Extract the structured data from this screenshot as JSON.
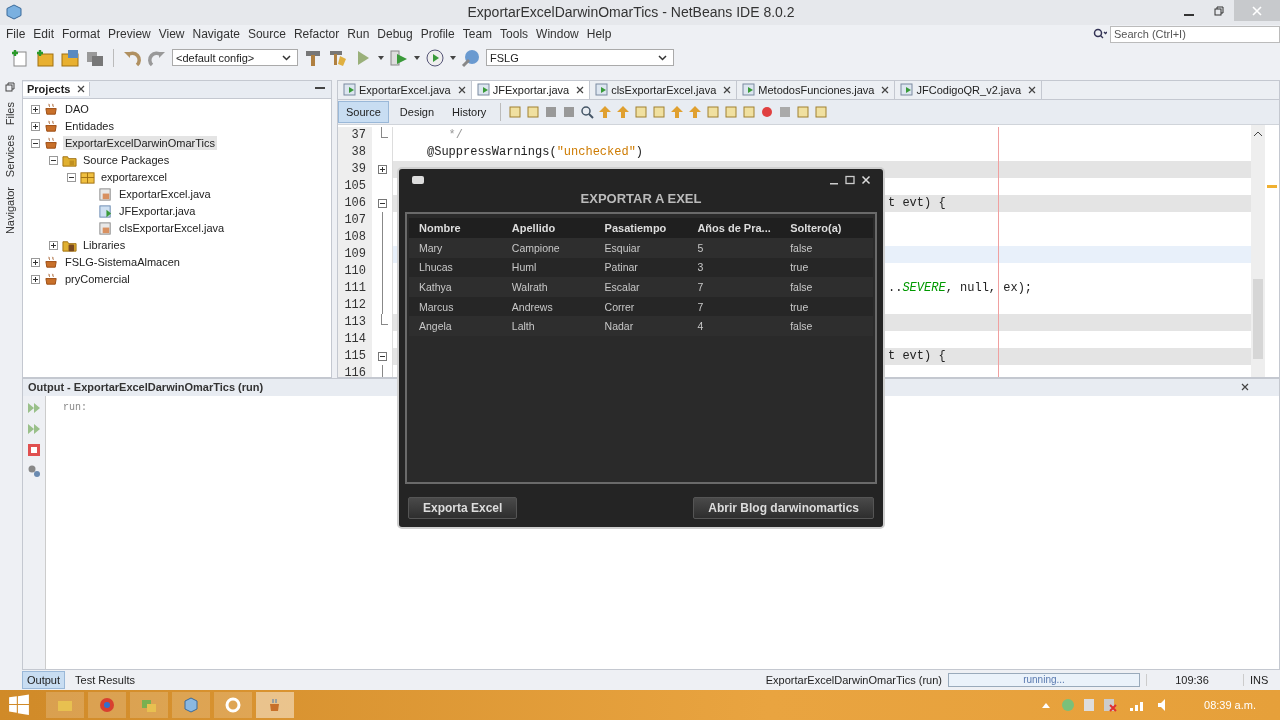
{
  "window": {
    "title": "ExportarExcelDarwinOmarTics - NetBeans IDE 8.0.2"
  },
  "menu": [
    "File",
    "Edit",
    "Format",
    "Preview",
    "View",
    "Navigate",
    "Source",
    "Refactor",
    "Run",
    "Debug",
    "Profile",
    "Team",
    "Tools",
    "Window",
    "Help"
  ],
  "toolbar": {
    "config": "<default config>",
    "project": "FSLG",
    "search_placeholder": "Search (Ctrl+I)"
  },
  "side_tabs": [
    "Files",
    "Services",
    "Navigator"
  ],
  "projects": {
    "title": "Projects",
    "tree": [
      {
        "label": "DAO",
        "kind": "project",
        "expanded": false,
        "selected": false
      },
      {
        "label": "Entidades",
        "kind": "project",
        "expanded": false,
        "selected": false
      },
      {
        "label": "ExportarExcelDarwinOmarTics",
        "kind": "project",
        "expanded": true,
        "selected": true,
        "children": [
          {
            "label": "Source Packages",
            "kind": "folder",
            "expanded": true,
            "selected": false,
            "children": [
              {
                "label": "exportarexcel",
                "kind": "package",
                "expanded": true,
                "selected": false,
                "children": [
                  {
                    "label": "ExportarExcel.java",
                    "kind": "file",
                    "selected": false
                  },
                  {
                    "label": "JFExportar.java",
                    "kind": "form",
                    "selected": false
                  },
                  {
                    "label": "clsExportarExcel.java",
                    "kind": "file",
                    "selected": false
                  }
                ]
              }
            ]
          },
          {
            "label": "Libraries",
            "kind": "library",
            "expanded": false,
            "selected": false
          }
        ]
      },
      {
        "label": "FSLG-SistemaAlmacen",
        "kind": "project",
        "expanded": false,
        "selected": false
      },
      {
        "label": "pryComercial",
        "kind": "project",
        "expanded": false,
        "selected": false
      }
    ]
  },
  "editor": {
    "tabs": [
      {
        "label": "ExportarExcel.java",
        "selected": false
      },
      {
        "label": "JFExportar.java",
        "selected": true
      },
      {
        "label": "clsExportarExcel.java",
        "selected": false
      },
      {
        "label": "MetodosFunciones.java",
        "selected": false
      },
      {
        "label": "JFCodigoQR_v2.java",
        "selected": false
      }
    ],
    "views": [
      {
        "label": "Source",
        "selected": true
      },
      {
        "label": "Design",
        "selected": false
      },
      {
        "label": "History",
        "selected": false
      }
    ],
    "lines": [
      {
        "number": "37",
        "fold": {
          "kind": "end"
        },
        "kind": "plain",
        "code": [
          {
            "t": "   */",
            "kind": "comment"
          }
        ]
      },
      {
        "number": "38",
        "kind": "plain",
        "code": [
          {
            "t": "@SuppressWarnings(",
            "kind": "plain"
          },
          {
            "t": "\"unchecked\"",
            "kind": "string"
          },
          {
            "t": ")",
            "kind": "plain"
          }
        ]
      },
      {
        "number": "39",
        "fold": {
          "kind": "expand"
        },
        "kind": "guarded"
      },
      {
        "number": "105",
        "kind": "plain"
      },
      {
        "number": "106",
        "fold": {
          "kind": "collapse"
        },
        "kind": "guarded",
        "tail": [
          {
            "t": "t evt) {",
            "kind": "plain"
          }
        ]
      },
      {
        "number": "107",
        "fold": {
          "kind": "line"
        },
        "kind": "plain"
      },
      {
        "number": "108",
        "fold": {
          "kind": "line"
        },
        "kind": "plain"
      },
      {
        "number": "109",
        "fold": {
          "kind": "line"
        },
        "kind": "current"
      },
      {
        "number": "110",
        "fold": {
          "kind": "line"
        },
        "kind": "plain"
      },
      {
        "number": "111",
        "fold": {
          "kind": "line"
        },
        "kind": "plain",
        "tail": [
          {
            "t": "..",
            "kind": "plain"
          },
          {
            "t": "SEVERE",
            "kind": "constant"
          },
          {
            "t": ", null, ex);",
            "kind": "plain"
          }
        ]
      },
      {
        "number": "112",
        "fold": {
          "kind": "line"
        },
        "kind": "plain"
      },
      {
        "number": "113",
        "fold": {
          "kind": "end"
        },
        "kind": "guarded"
      },
      {
        "number": "114",
        "kind": "plain"
      },
      {
        "number": "115",
        "fold": {
          "kind": "collapse"
        },
        "kind": "guarded",
        "tail": [
          {
            "t": "t evt) {",
            "kind": "plain"
          }
        ]
      },
      {
        "number": "116",
        "fold": {
          "kind": "line"
        },
        "kind": "plain"
      }
    ]
  },
  "dialog": {
    "title": "EXPORTAR A EXEL",
    "columns": [
      "Nombre",
      "Apellido",
      "Pasatiempo",
      "Años de Pra...",
      "Soltero(a)"
    ],
    "rows": [
      [
        "Mary",
        "Campione",
        "Esquiar",
        "5",
        "false"
      ],
      [
        "Lhucas",
        "Huml",
        "Patinar",
        "3",
        "true"
      ],
      [
        "Kathya",
        "Walrath",
        "Escalar",
        "7",
        "false"
      ],
      [
        "Marcus",
        "Andrews",
        "Correr",
        "7",
        "true"
      ],
      [
        "Angela",
        "Lalth",
        "Nadar",
        "4",
        "false"
      ]
    ],
    "buttons": [
      "Exporta Excel",
      "Abrir Blog darwinomartics"
    ]
  },
  "output": {
    "title": "Output - ExportarExcelDarwinOmarTics (run)",
    "text": "run:"
  },
  "status_bar": {
    "tabs": [
      {
        "label": "Output",
        "selected": true
      },
      {
        "label": "Test Results",
        "selected": false
      }
    ],
    "task": "ExportarExcelDarwinOmarTics (run)",
    "progress": "running...",
    "level": 1,
    "position": "109:36",
    "mode": "INS"
  },
  "taskbar": {
    "time": "08:39 a.m."
  }
}
